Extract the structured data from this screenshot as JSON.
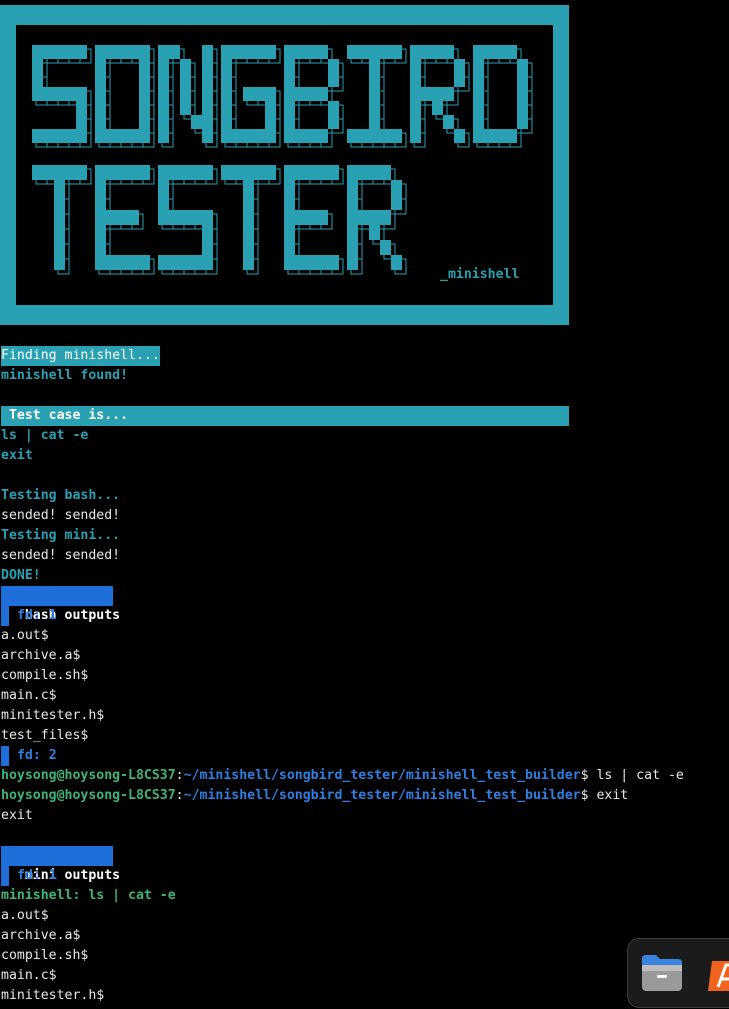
{
  "banner": {
    "word1": "SONGBIRD",
    "word2": "TESTER",
    "subtitle": "_minishell",
    "color": "#2aa0b3"
  },
  "lines": [
    {
      "text": "Finding minishell...",
      "style": "hl-cyan"
    },
    {
      "text": "minishell found!",
      "style": "cyan b"
    },
    {
      "text": " Test case is...",
      "style": "hl-cyan-wide"
    },
    {
      "text": "ls | cat -e",
      "style": "cyan b"
    },
    {
      "text": "exit",
      "style": "cyan b"
    },
    {
      "text": "Testing bash...",
      "style": "cyan b"
    },
    {
      "text": "sended! sended!",
      "style": "white"
    },
    {
      "text": "Testing mini...",
      "style": "cyan b"
    },
    {
      "text": "sended! sended!",
      "style": "white"
    },
    {
      "text": "DONE!",
      "style": "cyan b"
    }
  ],
  "bash_section": {
    "header": " bash outputs ",
    "fd1": " fd: 1",
    "fd1_lines": [
      "a.out$",
      "archive.a$",
      "compile.sh$",
      "main.c$",
      "minitester.h$",
      "test_files$"
    ],
    "fd2": " fd: 2",
    "prompt_user": "hoysong@hoysong-L8CS37",
    "prompt_path": "~/minishell/songbird_tester/minishell_test_builder",
    "cmd1": "$ ls | cat -e",
    "cmd2": "$ exit",
    "after": "exit"
  },
  "mini_section": {
    "header": " mini outputs ",
    "fd1": " fd: 1",
    "echo": "minishell: ls | cat -e",
    "fd1_lines": [
      "a.out$",
      "archive.a$",
      "compile.sh$",
      "main.c$",
      "minitester.h$"
    ]
  },
  "dock": {
    "icons": [
      "files-icon",
      "app-store-icon"
    ]
  },
  "colors": {
    "cyan": "#2aa0b3",
    "green": "#3fb37a",
    "blue": "#2f7fe0",
    "highlight_blue": "#1e6fd9"
  }
}
